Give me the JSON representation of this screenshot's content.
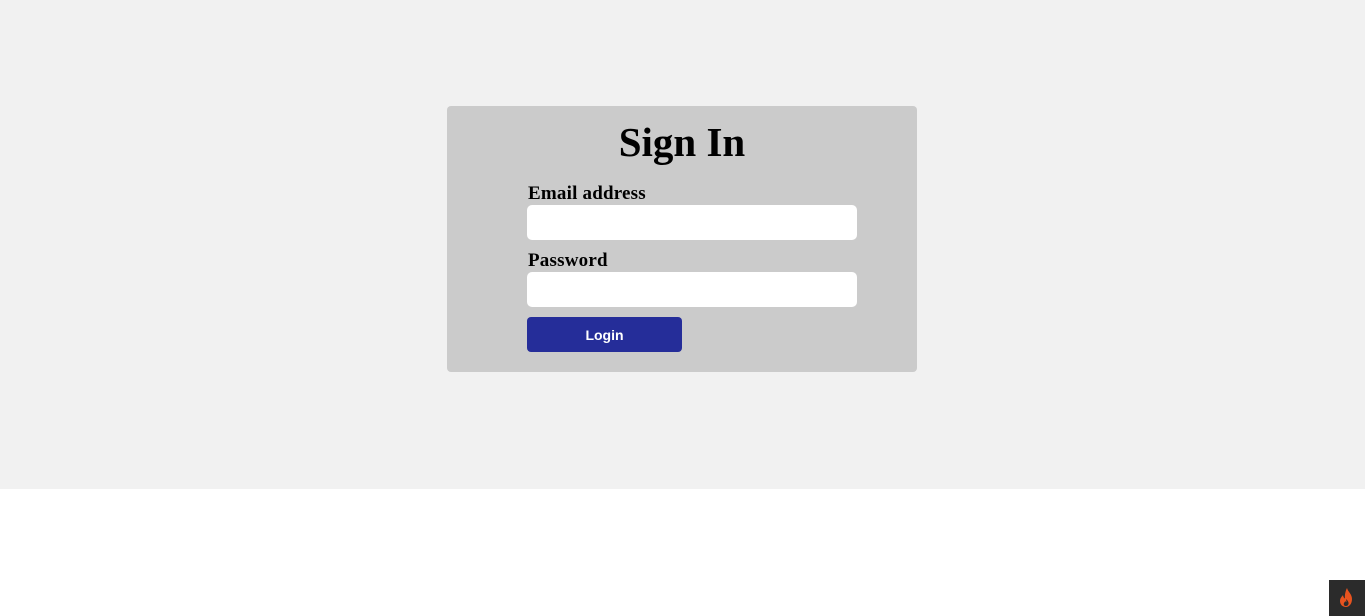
{
  "signin": {
    "title": "Sign In",
    "email_label": "Email address",
    "email_value": "",
    "password_label": "Password",
    "password_value": "",
    "login_label": "Login"
  },
  "badge": {
    "icon": "flame-icon"
  },
  "colors": {
    "page_background": "#f1f1f1",
    "card_background": "#cbcbcb",
    "button_background": "#252d99",
    "button_text": "#ffffff",
    "badge_background": "#2b2b2b",
    "flame": "#e8531f"
  }
}
